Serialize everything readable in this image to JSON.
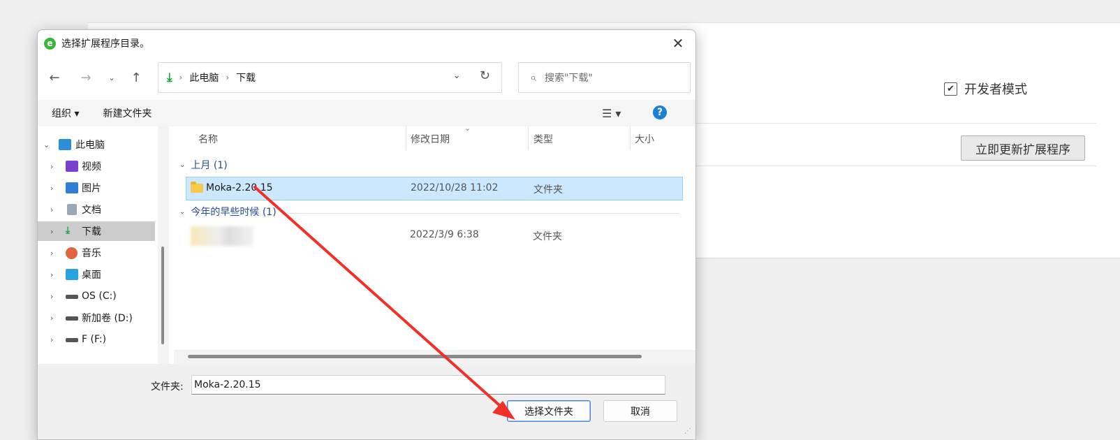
{
  "background": {
    "developer_mode_label": "开发者模式",
    "update_button_label": "立即更新扩展程序"
  },
  "dialog": {
    "title": "选择扩展程序目录。",
    "breadcrumbs": [
      "此电脑",
      "下载"
    ],
    "search_placeholder": "搜索\"下载\"",
    "toolbar": {
      "organize_label": "组织 ▾",
      "new_folder_label": "新建文件夹"
    },
    "nav_tree": [
      {
        "label": "此电脑",
        "icon": "computer-icon",
        "expanded": true
      },
      {
        "label": "视频",
        "icon": "video-icon"
      },
      {
        "label": "图片",
        "icon": "pictures-icon"
      },
      {
        "label": "文档",
        "icon": "documents-icon"
      },
      {
        "label": "下载",
        "icon": "download-icon",
        "selected": true
      },
      {
        "label": "音乐",
        "icon": "music-icon"
      },
      {
        "label": "桌面",
        "icon": "desktop-icon"
      },
      {
        "label": "OS (C:)",
        "icon": "drive-icon"
      },
      {
        "label": "新加卷 (D:)",
        "icon": "drive-icon"
      },
      {
        "label": "F (F:)",
        "icon": "drive-icon"
      }
    ],
    "columns": [
      "名称",
      "修改日期",
      "类型",
      "大小"
    ],
    "groups": [
      {
        "label": "上月 (1)",
        "rows": [
          {
            "name": "Moka-2.20.15",
            "date": "2022/10/28 11:02",
            "type": "文件夹",
            "selected": true
          }
        ]
      },
      {
        "label": "今年的早些时候 (1)",
        "rows": [
          {
            "name": "",
            "date": "2022/3/9 6:38",
            "type": "文件夹",
            "blurred": true
          }
        ]
      }
    ],
    "folder_field_label": "文件夹:",
    "folder_field_value": "Moka-2.20.15",
    "select_button_label": "选择文件夹",
    "cancel_button_label": "取消"
  },
  "colors": {
    "selection": "#cce8ff",
    "annotation_arrow": "#f0302a",
    "download_accent": "#1aa34a",
    "help_icon": "#1e7fd6"
  }
}
